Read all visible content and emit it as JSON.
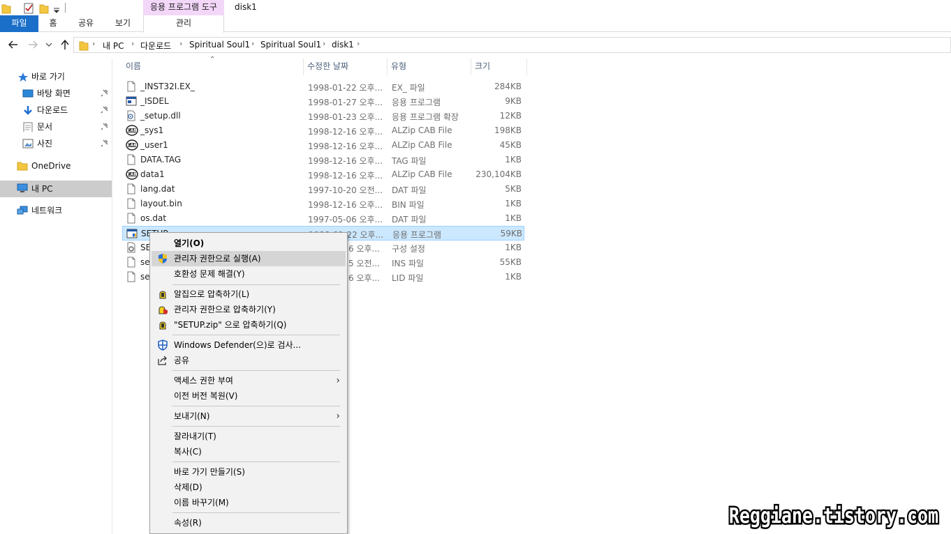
{
  "window": {
    "title": "disk1",
    "context_group": "응용 프로그램 도구"
  },
  "ribbon": {
    "tabs": [
      {
        "label": "파일"
      },
      {
        "label": "홈"
      },
      {
        "label": "공유"
      },
      {
        "label": "보기"
      },
      {
        "label": "관리"
      }
    ]
  },
  "address": {
    "crumbs": [
      "내 PC",
      "다운로드",
      "Spiritual Soul1",
      "Spiritual Soul1",
      "disk1"
    ]
  },
  "nav": {
    "quick_access": "바로 가기",
    "items": [
      {
        "label": "바탕 화면",
        "icon": "desktop-icon"
      },
      {
        "label": "다운로드",
        "icon": "download-icon"
      },
      {
        "label": "문서",
        "icon": "documents-icon"
      },
      {
        "label": "사진",
        "icon": "pictures-icon"
      }
    ],
    "onedrive": "OneDrive",
    "thispc": "내 PC",
    "network": "네트워크"
  },
  "columns": {
    "name": "이름",
    "date": "수정한 날짜",
    "type": "유형",
    "size": "크기"
  },
  "files": [
    {
      "name": "_INST32I.EX_",
      "date": "1998-01-22 오후...",
      "type": "EX_ 파일",
      "size": "284KB",
      "icon": "file-icon"
    },
    {
      "name": "_ISDEL",
      "date": "1998-01-27 오후...",
      "type": "응용 프로그램",
      "size": "9KB",
      "icon": "app-icon"
    },
    {
      "name": "_setup.dll",
      "date": "1998-01-23 오후...",
      "type": "응용 프로그램 확장",
      "size": "12KB",
      "icon": "dll-icon"
    },
    {
      "name": "_sys1",
      "date": "1998-12-16 오후...",
      "type": "ALZip CAB File",
      "size": "198KB",
      "icon": "cab-icon"
    },
    {
      "name": "_user1",
      "date": "1998-12-16 오후...",
      "type": "ALZip CAB File",
      "size": "45KB",
      "icon": "cab-icon"
    },
    {
      "name": "DATA.TAG",
      "date": "1998-12-16 오후...",
      "type": "TAG 파일",
      "size": "1KB",
      "icon": "file-icon"
    },
    {
      "name": "data1",
      "date": "1998-12-16 오후...",
      "type": "ALZip CAB File",
      "size": "230,104KB",
      "icon": "cab-icon"
    },
    {
      "name": "lang.dat",
      "date": "1997-10-20 오전...",
      "type": "DAT 파일",
      "size": "5KB",
      "icon": "file-icon"
    },
    {
      "name": "layout.bin",
      "date": "1998-12-16 오후...",
      "type": "BIN 파일",
      "size": "1KB",
      "icon": "file-icon"
    },
    {
      "name": "os.dat",
      "date": "1997-05-06 오후...",
      "type": "DAT 파일",
      "size": "1KB",
      "icon": "file-icon"
    },
    {
      "name": "SETUP",
      "date": "1998-01-22 오후...",
      "type": "응용 프로그램",
      "size": "59KB",
      "icon": "setup-app-icon",
      "selected": true
    },
    {
      "name": "SE",
      "date": "6 오후...",
      "type": "구성 설정",
      "size": "1KB",
      "icon": "config-icon"
    },
    {
      "name": "se",
      "date": "5 오전...",
      "type": "INS 파일",
      "size": "55KB",
      "icon": "file-icon"
    },
    {
      "name": "se",
      "date": "6 오후...",
      "type": "LID 파일",
      "size": "1KB",
      "icon": "file-icon"
    }
  ],
  "context_menu": {
    "items": [
      {
        "label": "열기(O)",
        "bold": true
      },
      {
        "label": "관리자 권한으로 실행(A)",
        "icon": "shield-icon",
        "hover": true
      },
      {
        "label": "호환성 문제 해결(Y)"
      },
      {
        "label": "알집으로 압축하기(L)",
        "icon": "alzip-icon"
      },
      {
        "label": "관리자 권한으로 압축하기(Y)",
        "icon": "alzip-shield-icon"
      },
      {
        "label": "\"SETUP.zip\" 으로 압축하기(Q)",
        "icon": "alzip-icon"
      },
      {
        "label": "Windows Defender(으)로 검사...",
        "icon": "defender-icon"
      },
      {
        "label": "공유",
        "icon": "share-icon"
      },
      {
        "label": "액세스 권한 부여",
        "submenu": true
      },
      {
        "label": "이전 버전 복원(V)"
      },
      {
        "label": "보내기(N)",
        "submenu": true
      },
      {
        "label": "잘라내기(T)"
      },
      {
        "label": "복사(C)"
      },
      {
        "label": "바로 가기 만들기(S)"
      },
      {
        "label": "삭제(D)"
      },
      {
        "label": "이름 바꾸기(M)"
      },
      {
        "label": "속성(R)"
      }
    ]
  },
  "watermark": "Reggiane.tistory.com",
  "colors": {
    "file_tab": "#1a6fc9",
    "context_group": "#f3d7f9",
    "selection": "#cce8ff",
    "selection_border": "#99d1ff",
    "menu_bg": "#f2f2f2",
    "menu_hover": "#d5d5d5"
  }
}
